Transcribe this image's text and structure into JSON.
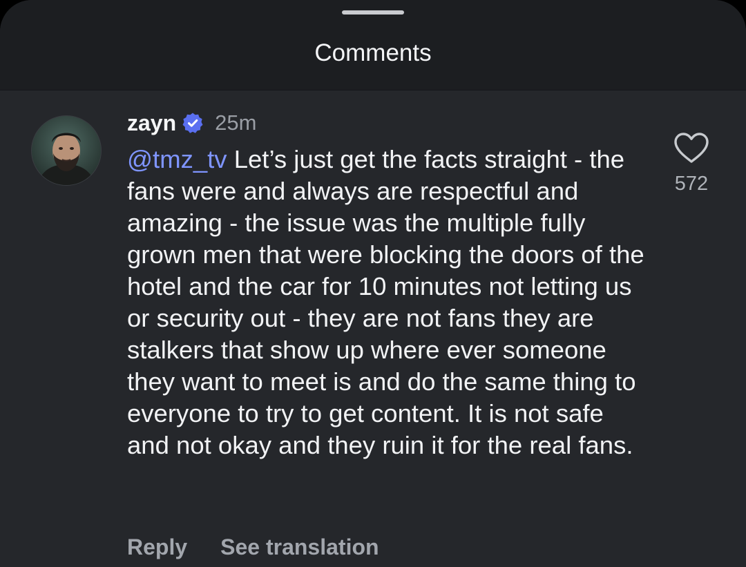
{
  "header": {
    "title": "Comments"
  },
  "comment": {
    "username": "zayn",
    "verified": true,
    "timestamp": "25m",
    "mention": "@tmz_tv",
    "text": "Let’s just get the facts straight - the fans were and always are respectful and amazing - the issue was the multiple fully grown men that were blocking the doors of the hotel and the car for 10 minutes not letting us or security out - they are not fans they are stalkers that show up where ever someone they want to meet is and do the same thing to everyone to try to get content. It is not safe and not okay and they ruin it for the real fans.",
    "likes": "572",
    "reply_label": "Reply",
    "translation_label": "See translation"
  },
  "icons": {
    "verified": "verified-badge-icon",
    "like": "heart-outline-icon"
  },
  "colors": {
    "background": "#25272b",
    "header_background": "#1c1e21",
    "mention": "#7f95ff",
    "verified_badge": "#5a6ff0"
  }
}
